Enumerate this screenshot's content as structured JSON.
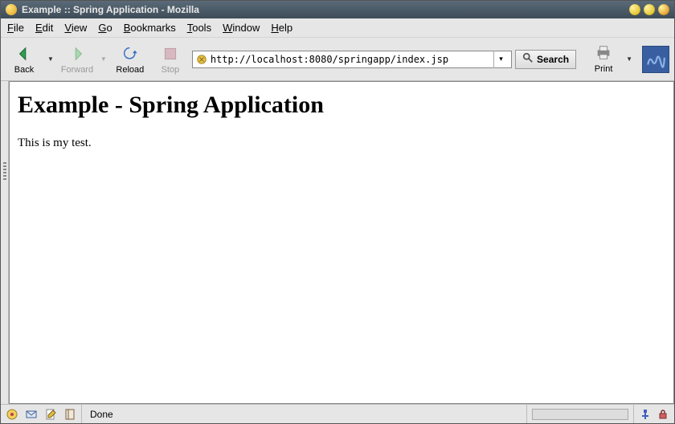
{
  "window": {
    "title": "Example :: Spring Application - Mozilla"
  },
  "menu": {
    "file": "File",
    "edit": "Edit",
    "view": "View",
    "go": "Go",
    "bookmarks": "Bookmarks",
    "tools": "Tools",
    "window": "Window",
    "help": "Help"
  },
  "toolbar": {
    "back": "Back",
    "forward": "Forward",
    "reload": "Reload",
    "stop": "Stop",
    "print": "Print",
    "search": "Search"
  },
  "url": "http://localhost:8080/springapp/index.jsp",
  "page": {
    "heading": "Example - Spring Application",
    "body": "This is my test."
  },
  "status": {
    "text": "Done"
  }
}
